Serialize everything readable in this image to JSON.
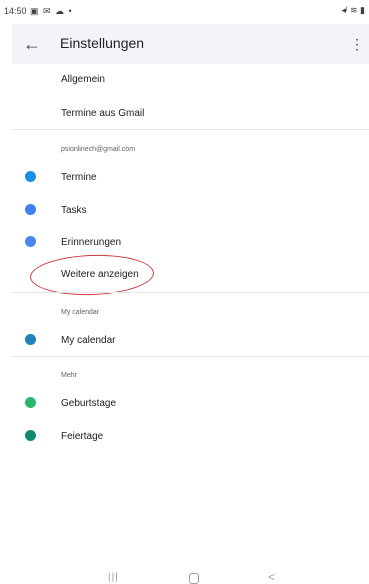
{
  "status_bar": {
    "time": "14:50",
    "left_icons": "▣ ✉ ☁ •",
    "right_icons": "◂ᴵ ≋ ▮"
  },
  "app_bar": {
    "back_glyph": "←",
    "title": "Einstellungen",
    "more_glyph": "⋮"
  },
  "general_items": [
    "Allgemein",
    "Termine aus Gmail"
  ],
  "account": {
    "email": "psionlinech@gmail.com",
    "calendars": [
      {
        "label": "Termine",
        "color": "#1a8fe3"
      },
      {
        "label": "Tasks",
        "color": "#3f7ff2"
      },
      {
        "label": "Erinnerungen",
        "color": "#4a86ee"
      }
    ],
    "show_more": "Weitere anzeigen"
  },
  "my_calendar": {
    "section_label": "My calendar",
    "calendars": [
      {
        "label": "My calendar",
        "color": "#1f84b8"
      }
    ]
  },
  "more": {
    "section_label": "Mehr",
    "calendars": [
      {
        "label": "Geburtstage",
        "color": "#2cb56c"
      },
      {
        "label": "Feiertage",
        "color": "#0f8a6a"
      }
    ]
  },
  "nav_bar": {
    "recent_glyph": "|||",
    "back_glyph": "<"
  }
}
